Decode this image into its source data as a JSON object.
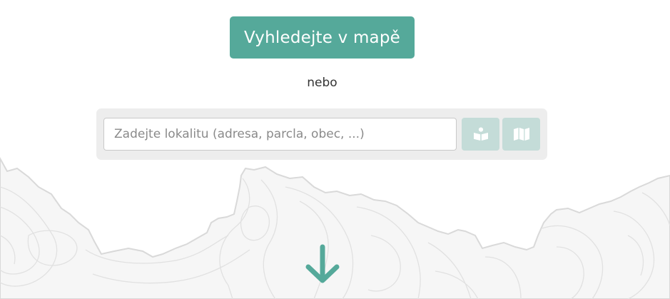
{
  "main": {
    "map_search_label": "Vyhledejte v mapě",
    "or_label": "nebo",
    "search": {
      "placeholder": "Zadejte lokalitu (adresa, parcla, obec, ...)",
      "value": ""
    },
    "cadastre_icon": "reader-book-icon",
    "map_icon": "folded-map-icon",
    "scroll_icon": "arrow-down-icon"
  },
  "colors": {
    "accent": "#55a99a",
    "icon_button_bg": "#c4dcd8",
    "panel_bg": "#ededed",
    "terrain_fill": "#f6f6f6",
    "terrain_line": "#dcdcdc"
  }
}
